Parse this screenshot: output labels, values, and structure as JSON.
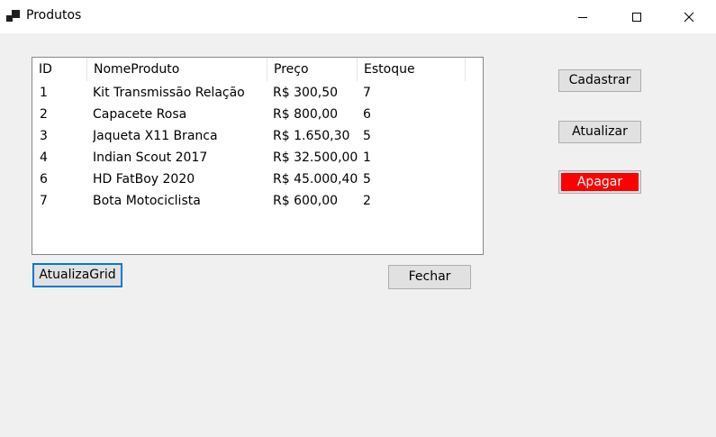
{
  "window": {
    "title": "Produtos"
  },
  "list": {
    "columns": [
      "ID",
      "NomeProduto",
      "Preço",
      "Estoque"
    ],
    "rows": [
      [
        "1",
        "Kit Transmissão Relação",
        "R$ 300,50",
        "7"
      ],
      [
        "2",
        "Capacete Rosa",
        "R$ 800,00",
        "6"
      ],
      [
        "3",
        "Jaqueta X11 Branca",
        "R$ 1.650,30",
        "5"
      ],
      [
        "4",
        "Indian Scout 2017",
        "R$ 32.500,00",
        "1"
      ],
      [
        "6",
        "HD FatBoy 2020",
        "R$ 45.000,40",
        "5"
      ],
      [
        "7",
        "Bota Motociclista",
        "R$ 600,00",
        "2"
      ]
    ]
  },
  "buttons": {
    "cadastrar": "Cadastrar",
    "atualizar": "Atualizar",
    "apagar": "Apagar",
    "atualiza_grid": "AtualizaGrid",
    "fechar": "Fechar"
  },
  "colors": {
    "apagar_bg": "#ff0000",
    "focus_border": "#0078d7"
  }
}
